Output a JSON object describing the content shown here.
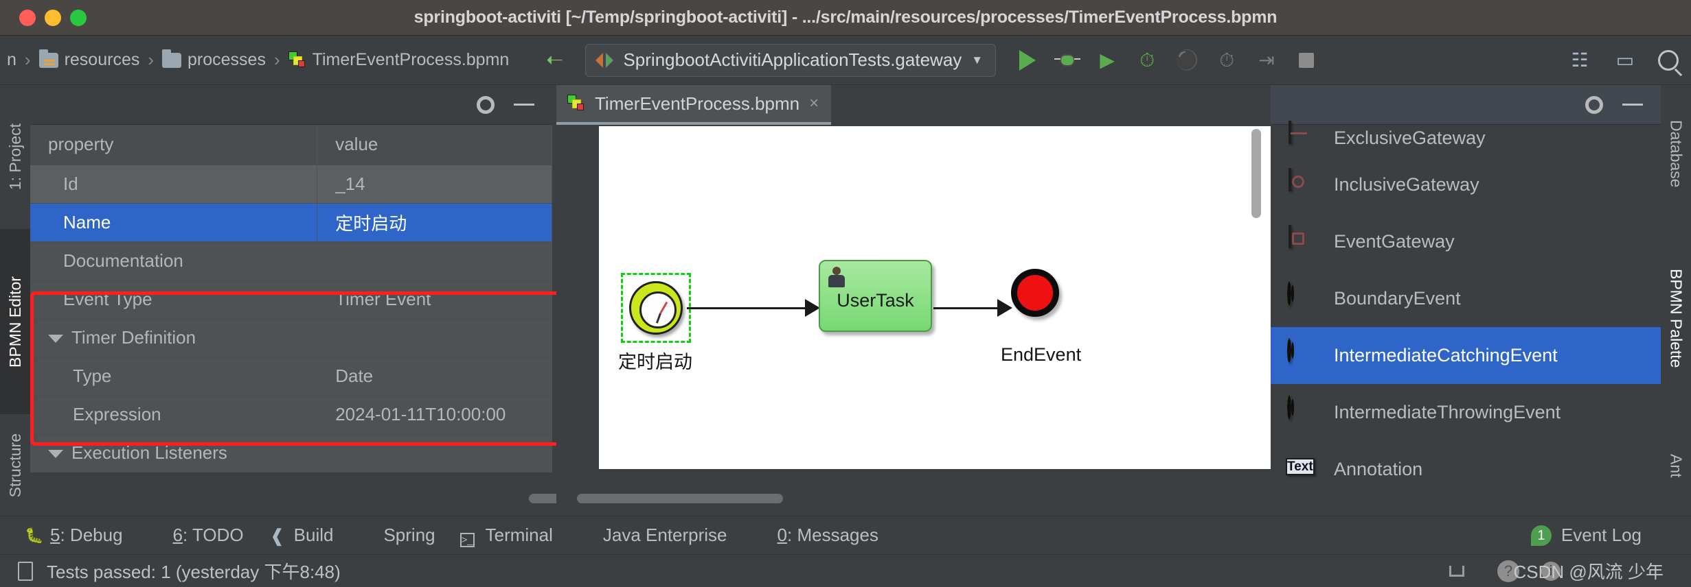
{
  "window": {
    "title": "springboot-activiti [~/Temp/springboot-activiti] - .../src/main/resources/processes/TimerEventProcess.bpmn"
  },
  "navbar": {
    "breadcrumbs": [
      {
        "label": "n",
        "icon": ""
      },
      {
        "label": "resources",
        "icon": "folder-resources-icon"
      },
      {
        "label": "processes",
        "icon": "folder-icon"
      },
      {
        "label": "TimerEventProcess.bpmn",
        "icon": "bpmn-file-icon"
      }
    ],
    "separator": "›",
    "run_config": {
      "label": "SpringbootActivitiApplicationTests.gateway",
      "caret": "▼"
    },
    "buttons": [
      {
        "name": "build-hammer",
        "glyph": "⚒"
      },
      {
        "name": "run",
        "glyph": "▶"
      },
      {
        "name": "debug",
        "glyph": "🐞"
      },
      {
        "name": "run-with-coverage",
        "glyph": "▶"
      },
      {
        "name": "profile",
        "glyph": "◴"
      },
      {
        "name": "attach-profiler",
        "glyph": "●"
      },
      {
        "name": "rerun",
        "glyph": "↻"
      },
      {
        "name": "step",
        "glyph": "⇥"
      },
      {
        "name": "stop",
        "glyph": "■"
      },
      {
        "name": "update-app",
        "glyph": "❐"
      },
      {
        "name": "layout",
        "glyph": "▭"
      },
      {
        "name": "search-everywhere",
        "glyph": "🔍"
      }
    ]
  },
  "left_strips": [
    {
      "label": "1: Project",
      "selected": false
    },
    {
      "label": "BPMN Editor",
      "selected": true
    },
    {
      "label": "Structure",
      "selected": false
    }
  ],
  "right_strips": [
    {
      "label": "Database"
    },
    {
      "label": "BPMN Palette"
    },
    {
      "label": "Ant"
    }
  ],
  "properties_panel": {
    "columns": [
      "property",
      "value"
    ],
    "rows": [
      {
        "property": "Id",
        "value": "_14",
        "indent": 1,
        "style": "zebra",
        "expander": false
      },
      {
        "property": "Name",
        "value": "定时启动",
        "indent": 1,
        "style": "selected",
        "expander": false
      },
      {
        "property": "Documentation",
        "value": "",
        "indent": 1,
        "style": "plain",
        "expander": false
      },
      {
        "property": "Event Type",
        "value": "Timer Event",
        "indent": 1,
        "style": "plain",
        "expander": false
      },
      {
        "property": "Timer Definition",
        "value": "",
        "indent": 0,
        "style": "plain",
        "expander": true
      },
      {
        "property": "Type",
        "value": "Date",
        "indent": 2,
        "style": "plain",
        "expander": false
      },
      {
        "property": "Expression",
        "value": "2024-01-11T10:00:00",
        "indent": 2,
        "style": "plain",
        "expander": false
      },
      {
        "property": "Execution Listeners",
        "value": "",
        "indent": 0,
        "style": "plain",
        "expander": true
      }
    ],
    "highlight_color": "#ff1f1f",
    "selection_color": "#2f65c8"
  },
  "editor": {
    "tab": {
      "label": "TimerEventProcess.bpmn",
      "close": "×",
      "icon": "bpmn-file-icon"
    },
    "diagram": {
      "start_event": {
        "label": "定时启动",
        "type": "timer-start-event",
        "selected": true
      },
      "task": {
        "label": "UserTask",
        "type": "user-task"
      },
      "end_event": {
        "label": "EndEvent",
        "type": "end-event"
      }
    }
  },
  "palette": {
    "items": [
      {
        "label": "ExclusiveGateway",
        "icon": "exclusive-gateway-icon",
        "selected": false
      },
      {
        "label": "InclusiveGateway",
        "icon": "inclusive-gateway-icon",
        "selected": false
      },
      {
        "label": "EventGateway",
        "icon": "event-gateway-icon",
        "selected": false
      },
      {
        "label": "BoundaryEvent",
        "icon": "boundary-event-icon",
        "selected": false
      },
      {
        "label": "IntermediateCatchingEvent",
        "icon": "intermediate-catching-event-icon",
        "selected": true
      },
      {
        "label": "IntermediateThrowingEvent",
        "icon": "intermediate-throwing-event-icon",
        "selected": false
      },
      {
        "label": "Annotation",
        "icon": "text-annotation-icon",
        "selected": false
      }
    ]
  },
  "bottom_bar": {
    "items": [
      {
        "key": "5",
        "label": ": Debug",
        "icon": "bug-icon"
      },
      {
        "key": "6",
        "label": ": TODO",
        "icon": "todo-icon"
      },
      {
        "key": "",
        "label": "Build",
        "icon": "build-icon"
      },
      {
        "key": "",
        "label": "Spring",
        "icon": "spring-icon"
      },
      {
        "key": "",
        "label": "Terminal",
        "icon": "terminal-icon"
      },
      {
        "key": "",
        "label": "Java Enterprise",
        "icon": "java-enterprise-icon"
      },
      {
        "key": "0",
        "label": ": Messages",
        "icon": "messages-icon"
      }
    ],
    "event_log": {
      "label": "Event Log",
      "count": "1"
    }
  },
  "status_bar": {
    "message": "Tests passed: 1 (yesterday 下午8:48)",
    "watermark": "CSDN @风流 少年"
  }
}
